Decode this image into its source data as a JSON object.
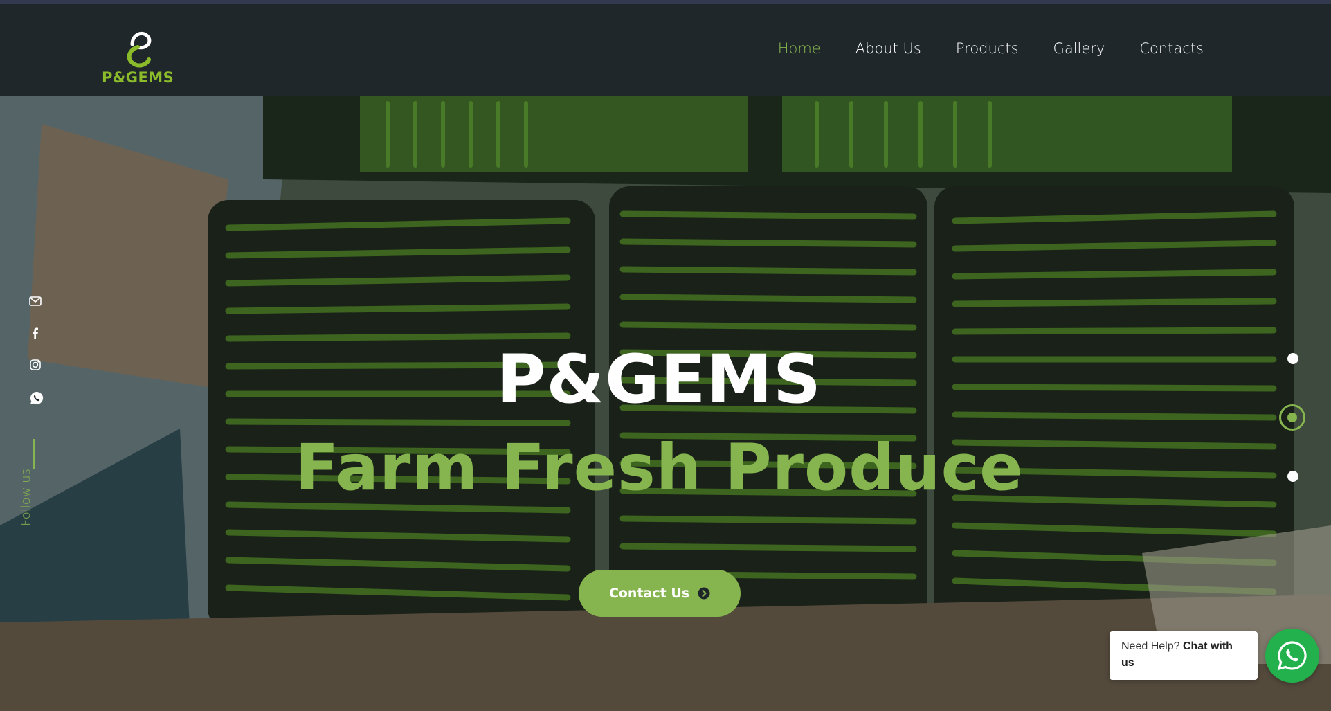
{
  "brand": {
    "name": "P&GEMS",
    "logo_color": "#8bbb2a"
  },
  "nav": {
    "items": [
      {
        "label": "Home",
        "active": true
      },
      {
        "label": "About Us",
        "active": false
      },
      {
        "label": "Products",
        "active": false
      },
      {
        "label": "Gallery",
        "active": false
      },
      {
        "label": "Contacts",
        "active": false
      }
    ]
  },
  "hero": {
    "title": "P&GEMS",
    "subtitle": "Farm Fresh Produce",
    "cta_label": "Contact Us",
    "accent_color": "#86b54f"
  },
  "social": {
    "icons": [
      "mail-icon",
      "facebook-icon",
      "instagram-icon",
      "whatsapp-icon"
    ],
    "follow_label": "Follow us"
  },
  "slider": {
    "slide_count": 3,
    "active_slide": 2
  },
  "chat": {
    "text_prefix": "Need Help?",
    "text_bold": "Chat with us",
    "button_color": "#22b14c"
  }
}
